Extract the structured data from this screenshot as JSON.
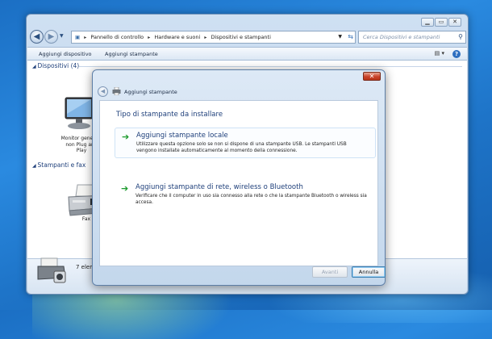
{
  "explorer": {
    "breadcrumb": [
      "Pannello di controllo",
      "Hardware e suoni",
      "Dispositivi e stampanti"
    ],
    "search_placeholder": "Cerca Dispositivi e stampanti",
    "toolbar": {
      "add_device": "Aggiungi dispositivo",
      "add_printer": "Aggiungi stampante"
    },
    "groups": {
      "devices": "Dispositivi (4)",
      "printers": "Stampanti e fax"
    },
    "devices": [
      {
        "label_line1": "Monitor generico",
        "label_line2": "non Plug and",
        "label_line3": "Play",
        "icon": "monitor-icon"
      }
    ],
    "printers": [
      {
        "label": "Fax",
        "icon": "fax-printer-icon"
      }
    ],
    "details_text": "7 elem"
  },
  "dialog": {
    "title": "Aggiungi stampante",
    "heading": "Tipo di stampante da installare",
    "options": [
      {
        "title": "Aggiungi stampante locale",
        "desc_line1": "Utilizzare questa opzione solo se non si dispone di una stampante USB. Le stampanti USB",
        "desc_line2": "vengono installate automaticamente al momento della connessione."
      },
      {
        "title": "Aggiungi stampante di rete, wireless o Bluetooth",
        "desc_line1": "Verificare che il computer in uso sia connesso alla rete o che la stampante Bluetooth o wireless sia",
        "desc_line2": "accesa."
      }
    ],
    "buttons": {
      "next": "Avanti",
      "cancel": "Annulla"
    }
  },
  "colors": {
    "accent": "#1e3f7a",
    "arrow": "#1c9a2d",
    "close": "#c8422a"
  }
}
